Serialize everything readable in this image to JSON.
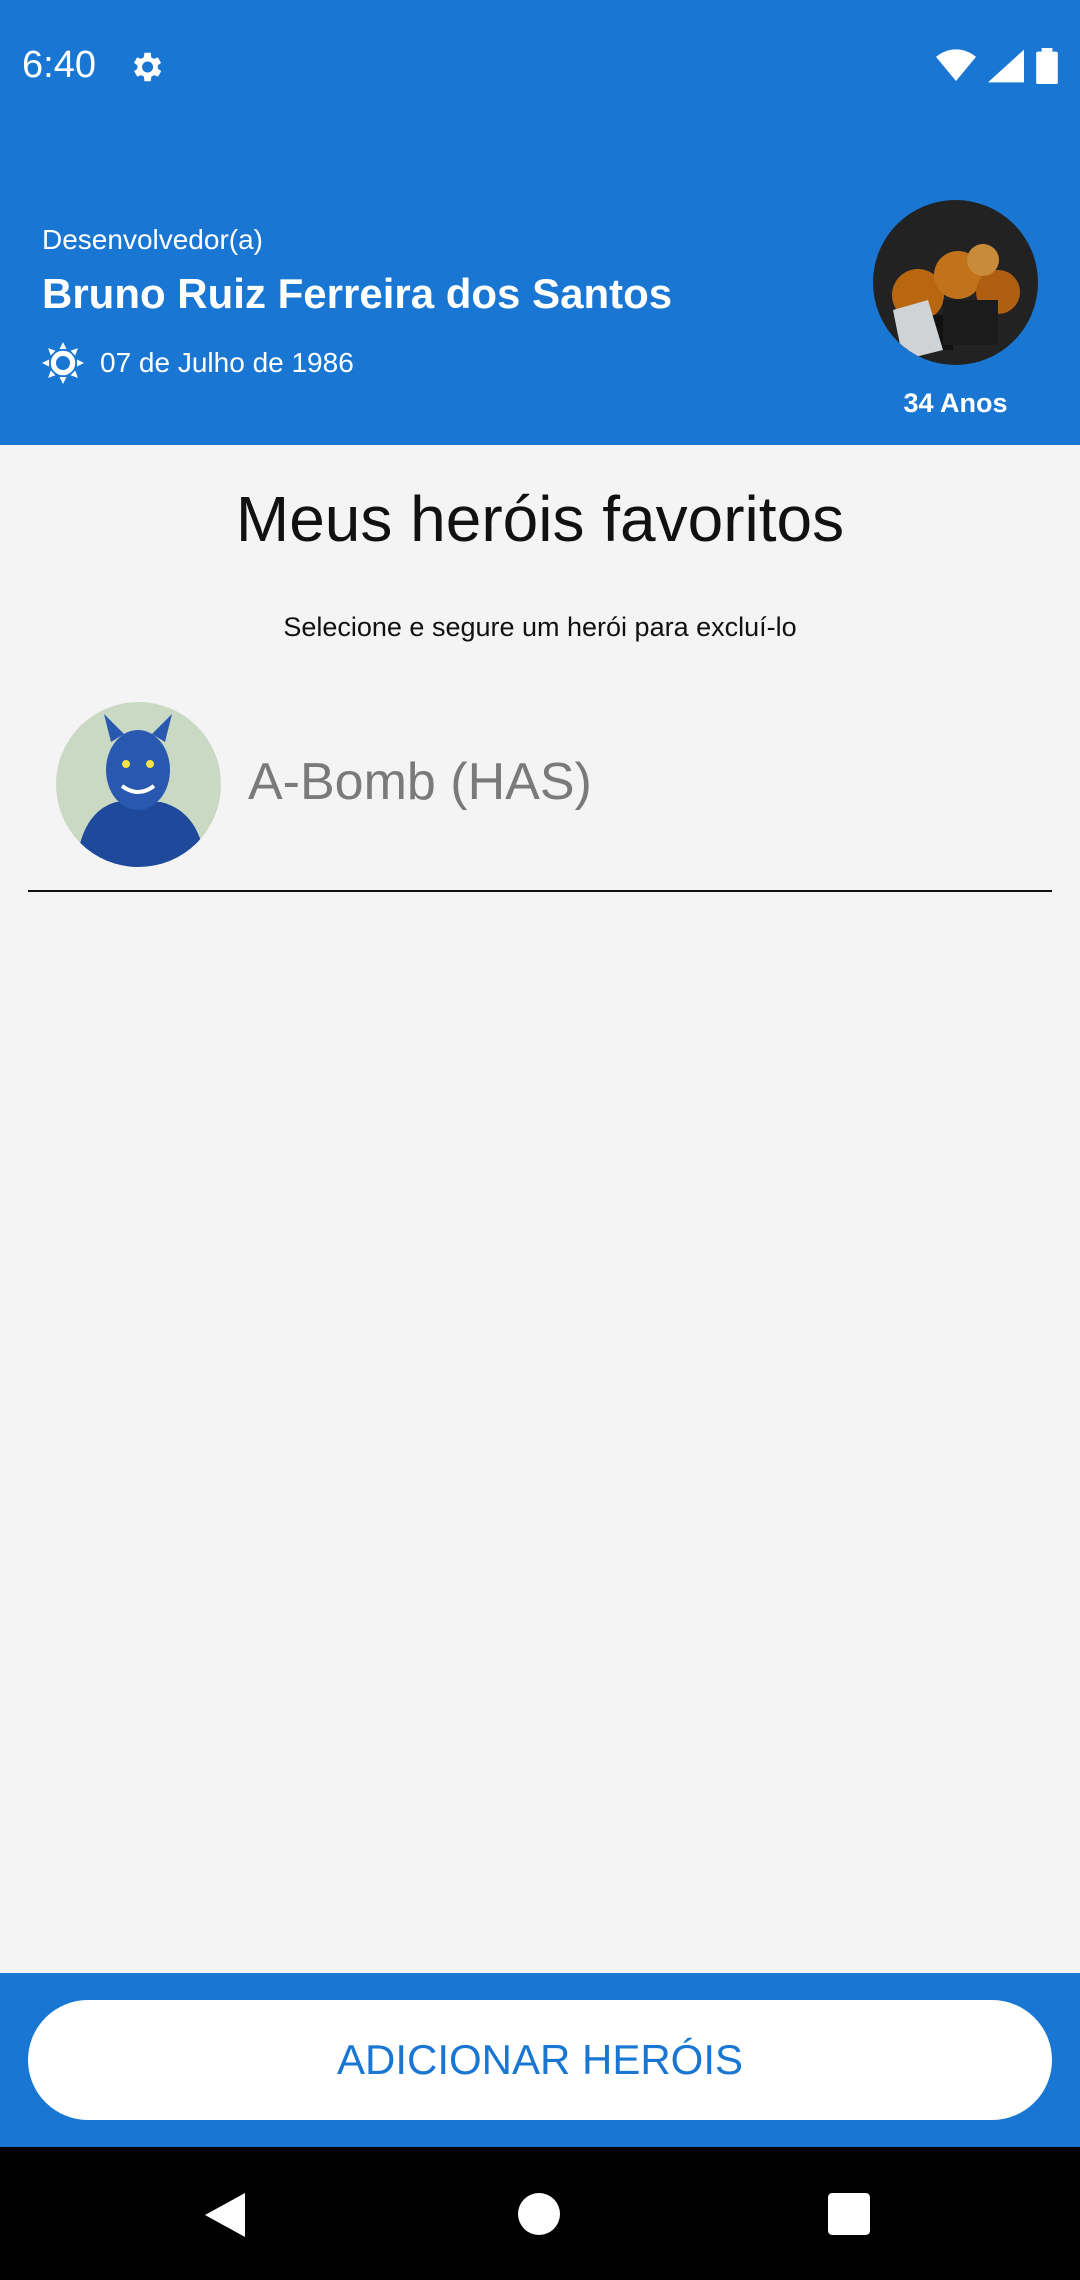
{
  "status_bar": {
    "time": "6:40",
    "icons": [
      "gear-icon",
      "wifi-icon",
      "signal-icon",
      "battery-icon"
    ]
  },
  "profile": {
    "role": "Desenvolvedor(a)",
    "name": "Bruno Ruiz Ferreira dos Santos",
    "birth_date": "07 de Julho de 1986",
    "birth_icon": "sun-icon",
    "age": "34 Anos"
  },
  "favorites": {
    "title": "Meus heróis favoritos",
    "hint": "Selecione e segure um herói para excluí-lo",
    "heroes": [
      {
        "name": "A-Bomb (HAS)"
      }
    ]
  },
  "actions": {
    "add_label": "ADICIONAR HERÓIS"
  },
  "nav": {
    "icons": [
      "back-icon",
      "home-icon",
      "recents-icon"
    ]
  },
  "colors": {
    "primary": "#1976d2",
    "background": "#f4f4f4"
  }
}
